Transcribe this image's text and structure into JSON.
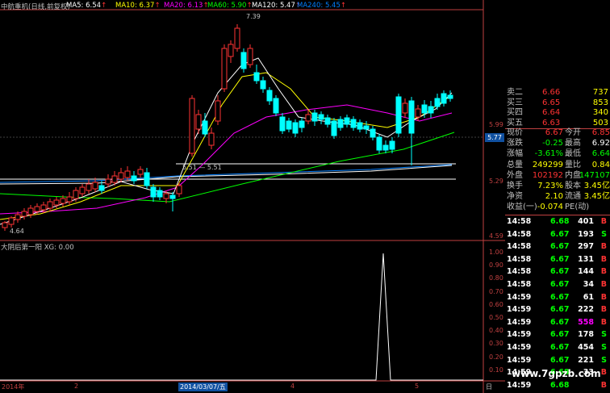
{
  "header": {
    "title": "中航重机(日线,前复权)",
    "ma": [
      {
        "label": "MA5: 6.54",
        "arrow": "↑",
        "color": "#ffffff"
      },
      {
        "label": "MA10: 6.37",
        "arrow": "↑",
        "color": "#ffff00"
      },
      {
        "label": "MA20: 6.13",
        "arrow": "↑",
        "color": "#ff00ff"
      },
      {
        "label": "MA60: 5.90",
        "arrow": "↑",
        "color": "#00ff00"
      },
      {
        "label": "MA120: 5.47",
        "arrow": "↑",
        "color": "#ffffff"
      },
      {
        "label": "MA240: 5.45",
        "arrow": "↑",
        "color": "#0080ff"
      }
    ]
  },
  "price_axis": {
    "labels": [
      "5.99",
      "5.29",
      "4.59"
    ],
    "current": "5.77"
  },
  "annotations": {
    "high": "7.39",
    "low": "4.64",
    "support": "5.51 — 5.51"
  },
  "indicator": {
    "label": "大阴后第一阳 XG: 0.00",
    "axis_labels": [
      "1.00",
      "0.90",
      "0.80",
      "0.70",
      "0.60",
      "0.50",
      "0.40",
      "0.30",
      "0.20",
      "0.10"
    ]
  },
  "dates": [
    "2014年",
    "2",
    "2014/03/07/五",
    "4",
    "5",
    "日"
  ],
  "quote": {
    "asks": [
      {
        "label": "卖二",
        "price": "6.66",
        "vol": "737"
      },
      {
        "label": "买三",
        "price": "6.65",
        "vol": "853"
      },
      {
        "label": "买四",
        "price": "6.64",
        "vol": "340"
      },
      {
        "label": "买五",
        "price": "6.63",
        "vol": "503"
      }
    ],
    "stats": [
      {
        "l1": "现价",
        "v1": "6.67",
        "l2": "今开",
        "v2": "6.85",
        "c1": "#ff3333",
        "c2": "#ff3333"
      },
      {
        "l1": "涨跌",
        "v1": "-0.25",
        "l2": "最高",
        "v2": "6.92",
        "c1": "#00ff00",
        "c2": "#ffffff"
      },
      {
        "l1": "涨幅",
        "v1": "-3.61%",
        "l2": "最低",
        "v2": "6.64",
        "c1": "#00ff00",
        "c2": "#00ff00"
      },
      {
        "l1": "总量",
        "v1": "249299",
        "l2": "量比",
        "v2": "0.84",
        "c1": "#ffff00",
        "c2": "#ffff00"
      },
      {
        "l1": "外盘",
        "v1": "102192",
        "l2": "内盘",
        "v2": "147107",
        "c1": "#ff3333",
        "c2": "#00ff00"
      },
      {
        "l1": "换手",
        "v1": "7.23%",
        "l2": "股本",
        "v2": "3.45亿",
        "c1": "#ffff00",
        "c2": "#ffff00"
      },
      {
        "l1": "净资",
        "v1": "2.10",
        "l2": "流通",
        "v2": "3.45亿",
        "c1": "#ffff00",
        "c2": "#ffff00"
      },
      {
        "l1": "收益(一)",
        "v1": "-0.074",
        "l2": "PE(动)",
        "v2": "",
        "c1": "#ffff00",
        "c2": "#ffff00"
      }
    ]
  },
  "ticks": [
    {
      "time": "14:58",
      "price": "6.68",
      "vol": "401",
      "side": "B"
    },
    {
      "time": "14:58",
      "price": "6.67",
      "vol": "193",
      "side": "S"
    },
    {
      "time": "14:58",
      "price": "6.67",
      "vol": "297",
      "side": "B"
    },
    {
      "time": "14:58",
      "price": "6.67",
      "vol": "131",
      "side": "B"
    },
    {
      "time": "14:58",
      "price": "6.67",
      "vol": "144",
      "side": "B"
    },
    {
      "time": "14:58",
      "price": "6.67",
      "vol": "34",
      "side": "B"
    },
    {
      "time": "14:59",
      "price": "6.67",
      "vol": "61",
      "side": "B"
    },
    {
      "time": "14:59",
      "price": "6.67",
      "vol": "222",
      "side": "B"
    },
    {
      "time": "14:59",
      "price": "6.67",
      "vol": "558",
      "side": "B"
    },
    {
      "time": "14:59",
      "price": "6.67",
      "vol": "178",
      "side": "S"
    },
    {
      "time": "14:59",
      "price": "6.67",
      "vol": "454",
      "side": "S"
    },
    {
      "time": "14:59",
      "price": "6.67",
      "vol": "221",
      "side": "S"
    },
    {
      "time": "14:59",
      "price": "6.68",
      "vol": "33",
      "side": "B"
    },
    {
      "time": "14:59",
      "price": "6.68",
      "vol": "",
      "side": "B"
    }
  ],
  "watermark": "www.7gpzb.com",
  "colors": {
    "up": "#ff3333",
    "down": "#00ffff",
    "buy": "#ff3333",
    "sell": "#00ff00",
    "price": "#00ff00",
    "time": "#ffffff",
    "axis": "#c04040"
  }
}
